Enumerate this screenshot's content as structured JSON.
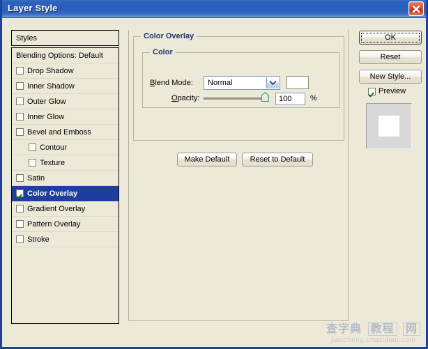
{
  "window": {
    "title": "Layer Style",
    "close_icon": "close-icon",
    "accent_color": "#2b5eba",
    "dialog_bg": "#ece9d8"
  },
  "sidebar": {
    "header": "Styles",
    "items": [
      {
        "label": "Blending Options: Default",
        "type": "header",
        "checked": false,
        "indent": false,
        "selected": false
      },
      {
        "label": "Drop Shadow",
        "type": "checkbox",
        "checked": false,
        "indent": false,
        "selected": false
      },
      {
        "label": "Inner Shadow",
        "type": "checkbox",
        "checked": false,
        "indent": false,
        "selected": false
      },
      {
        "label": "Outer Glow",
        "type": "checkbox",
        "checked": false,
        "indent": false,
        "selected": false
      },
      {
        "label": "Inner Glow",
        "type": "checkbox",
        "checked": false,
        "indent": false,
        "selected": false
      },
      {
        "label": "Bevel and Emboss",
        "type": "checkbox",
        "checked": false,
        "indent": false,
        "selected": false
      },
      {
        "label": "Contour",
        "type": "checkbox",
        "checked": false,
        "indent": true,
        "selected": false
      },
      {
        "label": "Texture",
        "type": "checkbox",
        "checked": false,
        "indent": true,
        "selected": false
      },
      {
        "label": "Satin",
        "type": "checkbox",
        "checked": false,
        "indent": false,
        "selected": false
      },
      {
        "label": "Color Overlay",
        "type": "checkbox",
        "checked": true,
        "indent": false,
        "selected": true
      },
      {
        "label": "Gradient Overlay",
        "type": "checkbox",
        "checked": false,
        "indent": false,
        "selected": false
      },
      {
        "label": "Pattern Overlay",
        "type": "checkbox",
        "checked": false,
        "indent": false,
        "selected": false
      },
      {
        "label": "Stroke",
        "type": "checkbox",
        "checked": false,
        "indent": false,
        "selected": false
      }
    ],
    "selected_color": "#1f3f9e"
  },
  "panel": {
    "group_title": "Color Overlay",
    "subgroup_title": "Color",
    "blend_mode_label": "Blend Mode:",
    "blend_mode_value": "Normal",
    "blend_mode_accesskey": "B",
    "color_swatch_value": "#ffffff",
    "opacity_label": "Opacity:",
    "opacity_accesskey": "O",
    "opacity_value": "100",
    "opacity_unit": "%",
    "make_default_label": "Make Default",
    "reset_default_label": "Reset to Default"
  },
  "actions": {
    "ok_label": "OK",
    "reset_label": "Reset",
    "new_style_label": "New Style...",
    "preview_label": "Preview",
    "preview_checked": true,
    "preview_swatch_color": "#ffffff"
  },
  "watermark": {
    "line1": "查字典",
    "line1_boxed_a": "教程",
    "line1_boxed_b": "网",
    "line2": "jiaocheng.chazidian.com"
  }
}
